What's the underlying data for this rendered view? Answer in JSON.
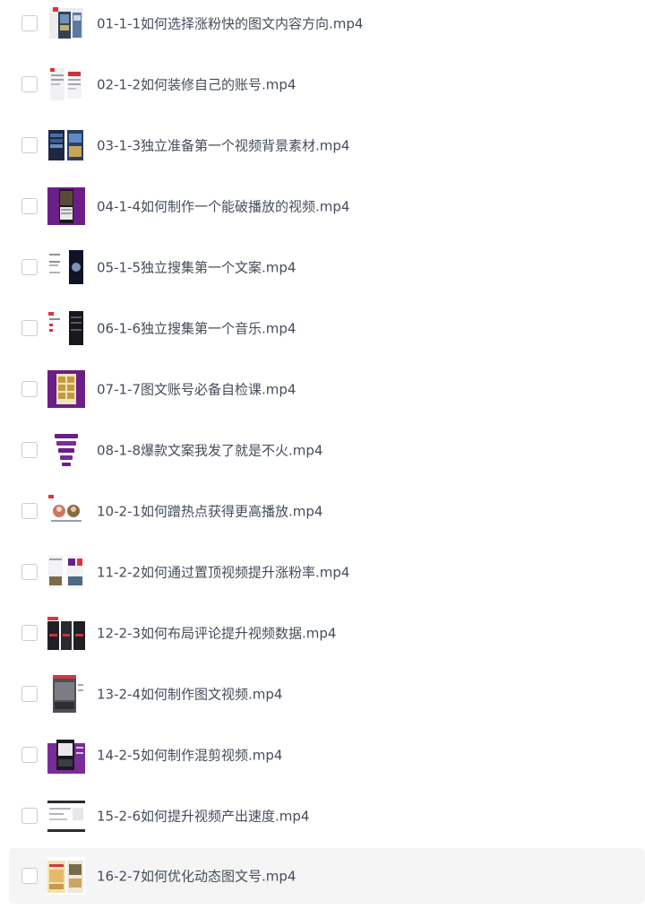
{
  "files": [
    {
      "name": "01-1-1如何选择涨粉快的图文内容方向.mp4",
      "thumb_icon": "video-thumbnail-icon"
    },
    {
      "name": "02-1-2如何装修自己的账号.mp4",
      "thumb_icon": "video-thumbnail-icon"
    },
    {
      "name": "03-1-3独立准备第一个视频背景素材.mp4",
      "thumb_icon": "video-thumbnail-icon"
    },
    {
      "name": "04-1-4如何制作一个能破播放的视频.mp4",
      "thumb_icon": "video-thumbnail-icon"
    },
    {
      "name": "05-1-5独立搜集第一个文案.mp4",
      "thumb_icon": "video-thumbnail-icon"
    },
    {
      "name": "06-1-6独立搜集第一个音乐.mp4",
      "thumb_icon": "video-thumbnail-icon"
    },
    {
      "name": "07-1-7图文账号必备自检课.mp4",
      "thumb_icon": "video-thumbnail-icon"
    },
    {
      "name": "08-1-8爆款文案我发了就是不火.mp4",
      "thumb_icon": "video-thumbnail-icon"
    },
    {
      "name": "10-2-1如何蹭热点获得更高播放.mp4",
      "thumb_icon": "video-thumbnail-icon"
    },
    {
      "name": "11-2-2如何通过置顶视频提升涨粉率.mp4",
      "thumb_icon": "video-thumbnail-icon"
    },
    {
      "name": "12-2-3如何布局评论提升视频数据.mp4",
      "thumb_icon": "video-thumbnail-icon"
    },
    {
      "name": "13-2-4如何制作图文视频.mp4",
      "thumb_icon": "video-thumbnail-icon"
    },
    {
      "name": "14-2-5如何制作混剪视频.mp4",
      "thumb_icon": "video-thumbnail-icon"
    },
    {
      "name": "15-2-6如何提升视频产出速度.mp4",
      "thumb_icon": "video-thumbnail-icon"
    },
    {
      "name": "16-2-7如何优化动态图文号.mp4",
      "thumb_icon": "video-thumbnail-icon"
    }
  ],
  "selected_index": 14,
  "colors": {
    "text": "#454d5a",
    "checkbox_border": "#c9ccd1",
    "hover_bg": "#f5f5f6",
    "thumb_purple": "#6b1f86",
    "thumb_red": "#d9363e",
    "thumb_dark": "#1b1b22"
  }
}
